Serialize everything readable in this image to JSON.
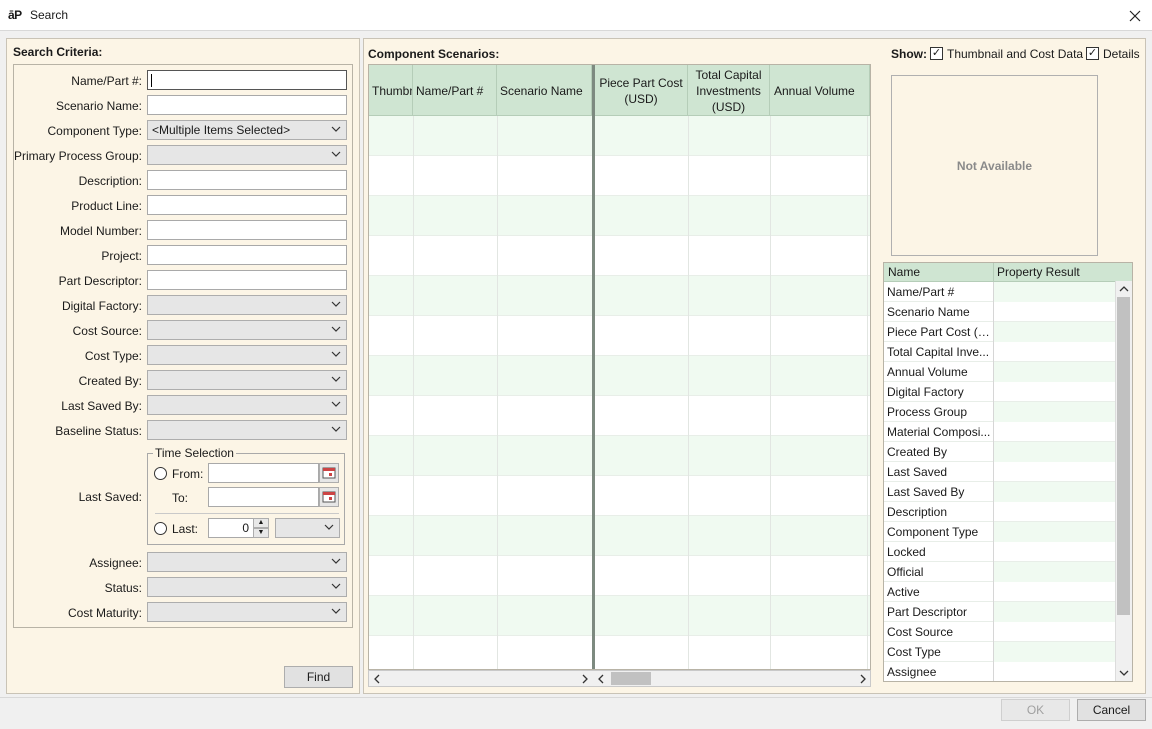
{
  "window": {
    "logo": "āP",
    "title": "Search"
  },
  "criteria": {
    "title": "Search Criteria:",
    "fields": {
      "name_part": {
        "label": "Name/Part #:",
        "value": ""
      },
      "scenario_name": {
        "label": "Scenario Name:",
        "value": ""
      },
      "component_type": {
        "label": "Component Type:",
        "value": "<Multiple Items Selected>"
      },
      "primary_process_group": {
        "label": "Primary Process Group:",
        "value": ""
      },
      "description": {
        "label": "Description:",
        "value": ""
      },
      "product_line": {
        "label": "Product Line:",
        "value": ""
      },
      "model_number": {
        "label": "Model Number:",
        "value": ""
      },
      "project": {
        "label": "Project:",
        "value": ""
      },
      "part_descriptor": {
        "label": "Part Descriptor:",
        "value": ""
      },
      "digital_factory": {
        "label": "Digital Factory:",
        "value": ""
      },
      "cost_source": {
        "label": "Cost Source:",
        "value": ""
      },
      "cost_type": {
        "label": "Cost Type:",
        "value": ""
      },
      "created_by": {
        "label": "Created By:",
        "value": ""
      },
      "last_saved_by": {
        "label": "Last Saved By:",
        "value": ""
      },
      "baseline_status": {
        "label": "Baseline Status:",
        "value": ""
      },
      "assignee": {
        "label": "Assignee:",
        "value": ""
      },
      "status": {
        "label": "Status:",
        "value": ""
      },
      "cost_maturity": {
        "label": "Cost Maturity:",
        "value": ""
      }
    },
    "last_saved": {
      "label": "Last Saved:",
      "group_title": "Time Selection",
      "from_label": "From:",
      "to_label": "To:",
      "last_label": "Last:",
      "last_value": "0"
    },
    "find_label": "Find"
  },
  "scenarios": {
    "title": "Component Scenarios:",
    "columns": [
      "Thumbnail",
      "Name/Part #",
      "Scenario Name",
      "Piece Part Cost (USD)",
      "Total Capital Investments (USD)",
      "Annual Volume"
    ]
  },
  "show": {
    "label": "Show:",
    "thumbnail_cost": "Thumbnail and Cost Data",
    "details": "Details"
  },
  "thumbnail": {
    "text": "Not Available"
  },
  "properties": {
    "headers": {
      "name": "Name",
      "result": "Property Result"
    },
    "rows": [
      "Name/Part #",
      "Scenario Name",
      "Piece Part Cost (U...",
      "Total Capital Inve...",
      "Annual Volume",
      "Digital Factory",
      "Process Group",
      "Material Composi...",
      "Created By",
      "Last Saved",
      "Last Saved By",
      "Description",
      "Component Type",
      "Locked",
      "Official",
      "Active",
      "Part Descriptor",
      "Cost Source",
      "Cost Type",
      "Assignee"
    ]
  },
  "footer": {
    "ok": "OK",
    "cancel": "Cancel"
  }
}
